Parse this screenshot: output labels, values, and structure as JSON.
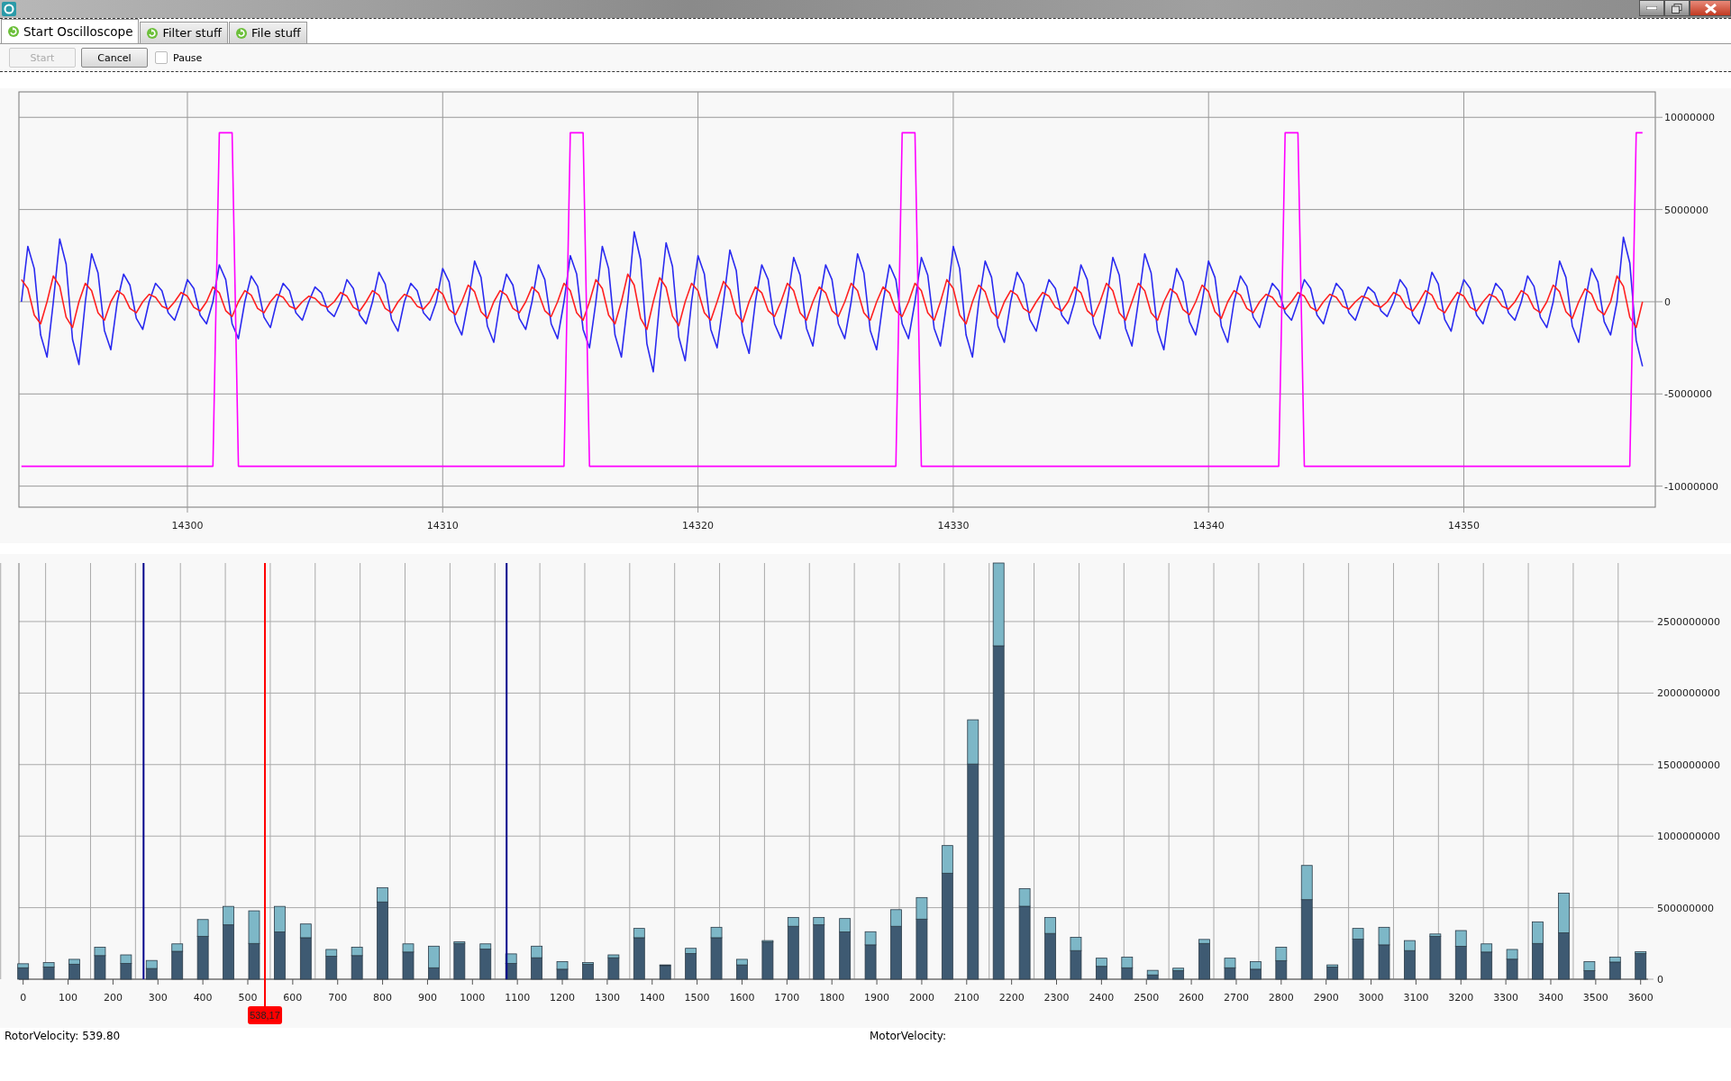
{
  "tabs": [
    {
      "label": "Start Oscilloscope",
      "selected": true
    },
    {
      "label": "Filter stuff",
      "selected": false
    },
    {
      "label": "File stuff",
      "selected": false
    }
  ],
  "toolbar": {
    "buttons": [
      {
        "label": "Start",
        "disabled": true
      },
      {
        "label": "Cancel",
        "disabled": false
      }
    ],
    "pause": {
      "label": "Pause",
      "checked": false
    }
  },
  "time_chart": {
    "chart_data": {
      "type": "line",
      "xlim": [
        14293.4,
        14357.5
      ],
      "ylim": [
        -11140000,
        11380000
      ],
      "grid": true,
      "xticks": [
        14300,
        14310,
        14320,
        14330,
        14340,
        14350
      ],
      "yticks": [
        -10000000,
        -5000000,
        0,
        5000000,
        10000000
      ],
      "x": [
        14293.5,
        14293.75,
        14294,
        14294.25,
        14294.5,
        14294.75,
        14295,
        14295.25,
        14295.5,
        14295.75,
        14296,
        14296.25,
        14296.5,
        14296.75,
        14297,
        14297.25,
        14297.5,
        14297.75,
        14298,
        14298.25,
        14298.5,
        14298.75,
        14299,
        14299.25,
        14299.5,
        14299.75,
        14300,
        14300.25,
        14300.5,
        14300.75,
        14301,
        14301.25,
        14301.5,
        14301.75,
        14302,
        14302.25,
        14302.5,
        14302.75,
        14303,
        14303.25,
        14303.5,
        14303.75,
        14304,
        14304.25,
        14304.5,
        14304.75,
        14305,
        14305.25,
        14305.5,
        14305.75,
        14306,
        14306.25,
        14306.5,
        14306.75,
        14307,
        14307.25,
        14307.5,
        14307.75,
        14308,
        14308.25,
        14308.5,
        14308.75,
        14309,
        14309.25,
        14309.5,
        14309.75,
        14310,
        14310.25,
        14310.5,
        14310.75,
        14311,
        14311.25,
        14311.5,
        14311.75,
        14312,
        14312.25,
        14312.5,
        14312.75,
        14313,
        14313.25,
        14313.5,
        14313.75,
        14314,
        14314.25,
        14314.5,
        14314.75,
        14315,
        14315.25,
        14315.5,
        14315.75,
        14316,
        14316.25,
        14316.5,
        14316.75,
        14317,
        14317.25,
        14317.5,
        14317.75,
        14318,
        14318.25,
        14318.5,
        14318.75,
        14319,
        14319.25,
        14319.5,
        14319.75,
        14320,
        14320.25,
        14320.5,
        14320.75,
        14321,
        14321.25,
        14321.5,
        14321.75,
        14322,
        14322.25,
        14322.5,
        14322.75,
        14323,
        14323.25,
        14323.5,
        14323.75,
        14324,
        14324.25,
        14324.5,
        14324.75,
        14325,
        14325.25,
        14325.5,
        14325.75,
        14326,
        14326.25,
        14326.5,
        14326.75,
        14327,
        14327.25,
        14327.5,
        14327.75,
        14328,
        14328.25,
        14328.5,
        14328.75,
        14329,
        14329.25,
        14329.5,
        14329.75,
        14330,
        14330.25,
        14330.5,
        14330.75,
        14331,
        14331.25,
        14331.5,
        14331.75,
        14332,
        14332.25,
        14332.5,
        14332.75,
        14333,
        14333.25,
        14333.5,
        14333.75,
        14334,
        14334.25,
        14334.5,
        14334.75,
        14335,
        14335.25,
        14335.5,
        14335.75,
        14336,
        14336.25,
        14336.5,
        14336.75,
        14337,
        14337.25,
        14337.5,
        14337.75,
        14338,
        14338.25,
        14338.5,
        14338.75,
        14339,
        14339.25,
        14339.5,
        14339.75,
        14340,
        14340.25,
        14340.5,
        14340.75,
        14341,
        14341.25,
        14341.5,
        14341.75,
        14342,
        14342.25,
        14342.5,
        14342.75,
        14343,
        14343.25,
        14343.5,
        14343.75,
        14344,
        14344.25,
        14344.5,
        14344.75,
        14345,
        14345.25,
        14345.5,
        14345.75,
        14346,
        14346.25,
        14346.5,
        14346.75,
        14347,
        14347.25,
        14347.5,
        14347.75,
        14348,
        14348.25,
        14348.5,
        14348.75,
        14349,
        14349.25,
        14349.5,
        14349.75,
        14350,
        14350.25,
        14350.5,
        14350.75,
        14351,
        14351.25,
        14351.5,
        14351.75,
        14352,
        14352.25,
        14352.5,
        14352.75,
        14353,
        14353.25,
        14353.5,
        14353.75,
        14354,
        14354.25,
        14354.5,
        14354.75,
        14355,
        14355.25,
        14355.5,
        14355.75,
        14356,
        14356.25,
        14356.5,
        14356.75,
        14357
      ],
      "series": [
        {
          "color": "#2a2af0",
          "values": [
            0,
            3000000.0,
            1800000.0,
            -1800000.0,
            -3000000.0,
            0,
            3400000.0,
            2040000.0,
            -2040000.0,
            -3400000.0,
            0,
            2600000.0,
            1560000.0,
            -1560000.0,
            -2600000.0,
            0,
            1500000.0,
            900000.0,
            -900000.0,
            -1500000.0,
            0,
            1000000.0,
            600000.0,
            -600000.0,
            -1000000.0,
            0,
            1200000.0,
            720000.0,
            -720000.0,
            -1200000.0,
            0,
            2000000.0,
            1200000.0,
            -1200000.0,
            -2000000.0,
            0,
            1400000.0,
            840000.0,
            -840000.0,
            -1400000.0,
            0,
            1000000.0,
            600000.0,
            -600000.0,
            -1000000.0,
            0,
            800000.0,
            480000.0,
            -480000.0,
            -800000.0,
            0,
            1200000.0,
            720000.0,
            -720000.0,
            -1200000.0,
            0,
            1600000.0,
            960000.0,
            -960000.0,
            -1600000.0,
            0,
            1000000.0,
            600000.0,
            -600000.0,
            -1000000.0,
            0,
            1800000.0,
            1080000.0,
            -1080000.0,
            -1800000.0,
            0,
            2200000.0,
            1320000.0,
            -1320000.0,
            -2200000.0,
            0,
            1500000.0,
            900000.0,
            -900000.0,
            -1500000.0,
            0,
            2000000.0,
            1200000.0,
            -1200000.0,
            -2000000.0,
            0,
            2500000.0,
            1500000.0,
            -1500000.0,
            -2500000.0,
            0,
            3000000.0,
            1800000.0,
            -1800000.0,
            -3000000.0,
            0,
            3800000.0,
            2280000.0,
            -2280000.0,
            -3800000.0,
            0,
            3200000.0,
            1920000.0,
            -1920000.0,
            -3200000.0,
            0,
            2500000.0,
            1500000.0,
            -1500000.0,
            -2500000.0,
            0,
            2800000.0,
            1680000.0,
            -1680000.0,
            -2800000.0,
            0,
            2000000.0,
            1200000.0,
            -1200000.0,
            -2000000.0,
            0,
            2400000.0,
            1440000.0,
            -1440000.0,
            -2400000.0,
            0,
            2000000.0,
            1200000.0,
            -1200000.0,
            -2000000.0,
            0,
            2600000.0,
            1560000.0,
            -1560000.0,
            -2600000.0,
            0,
            2000000.0,
            1200000.0,
            -1200000.0,
            -2000000.0,
            0,
            2400000.0,
            1440000.0,
            -1440000.0,
            -2400000.0,
            0,
            3000000.0,
            1800000.0,
            -1800000.0,
            -3000000.0,
            0,
            2200000.0,
            1320000.0,
            -1320000.0,
            -2200000.0,
            0,
            1600000.0,
            960000.0,
            -960000.0,
            -1600000.0,
            0,
            1200000.0,
            720000.0,
            -720000.0,
            -1200000.0,
            0,
            2000000.0,
            1200000.0,
            -1200000.0,
            -2000000.0,
            0,
            2400000.0,
            1440000.0,
            -1440000.0,
            -2400000.0,
            0,
            2600000.0,
            1560000.0,
            -1560000.0,
            -2600000.0,
            0,
            1800000.0,
            1080000.0,
            -1080000.0,
            -1800000.0,
            0,
            2200000.0,
            1320000.0,
            -1320000.0,
            -2200000.0,
            0,
            1400000.0,
            840000.0,
            -840000.0,
            -1400000.0,
            0,
            1000000.0,
            600000.0,
            -600000.0,
            -1000000.0,
            0,
            1200000.0,
            720000.0,
            -720000.0,
            -1200000.0,
            0,
            1000000.0,
            600000.0,
            -600000.0,
            -1000000.0,
            0,
            800000.0,
            480000.0,
            -480000.0,
            -800000.0,
            0,
            1200000.0,
            720000.0,
            -720000.0,
            -1200000.0,
            0,
            1600000.0,
            960000.0,
            -960000.0,
            -1600000.0,
            0,
            1200000.0,
            720000.0,
            -720000.0,
            -1200000.0,
            0,
            1000000.0,
            600000.0,
            -600000.0,
            -1000000.0,
            0,
            1400000.0,
            840000.0,
            -840000.0,
            -1400000.0,
            0,
            2200000.0,
            1320000.0,
            -1320000.0,
            -2200000.0,
            0,
            1800000.0,
            1080000.0,
            -1080000.0,
            -1800000.0,
            0,
            3500000.0,
            2100000.0,
            -2100000.0,
            -3500000.0
          ]
        },
        {
          "color": "#ff2020",
          "values": [
            1200000.0,
            720000.0,
            -720000.0,
            -1200000.0,
            0,
            1400000.0,
            840000.0,
            -840000.0,
            -1400000.0,
            0,
            1000000.0,
            600000.0,
            -600000.0,
            -1000000.0,
            0,
            600000.0,
            360000.0,
            -360000.0,
            -600000.0,
            0,
            400000.0,
            240000.0,
            -240000.0,
            -400000.0,
            0,
            500000.0,
            300000.0,
            -300000.0,
            -500000.0,
            0,
            800000.0,
            480000.0,
            -480000.0,
            -800000.0,
            0,
            600000.0,
            360000.0,
            -360000.0,
            -600000.0,
            0,
            400000.0,
            240000.0,
            -240000.0,
            -400000.0,
            0,
            300000.0,
            180000.0,
            -180000.0,
            -300000.0,
            0,
            500000.0,
            300000.0,
            -300000.0,
            -500000.0,
            0,
            600000.0,
            360000.0,
            -360000.0,
            -600000.0,
            0,
            400000.0,
            240000.0,
            -240000.0,
            -400000.0,
            0,
            700000.0,
            420000.0,
            -420000.0,
            -700000.0,
            0,
            900000.0,
            540000.0,
            -540000.0,
            -900000.0,
            0,
            600000.0,
            360000.0,
            -360000.0,
            -600000.0,
            0,
            800000.0,
            480000.0,
            -480000.0,
            -800000.0,
            0,
            1000000.0,
            600000.0,
            -600000.0,
            -1000000.0,
            0,
            1200000.0,
            720000.0,
            -720000.0,
            -1200000.0,
            0,
            1500000.0,
            900000.0,
            -900000.0,
            -1500000.0,
            0,
            1300000.0,
            780000.0,
            -780000.0,
            -1300000.0,
            0,
            1000000.0,
            600000.0,
            -600000.0,
            -1000000.0,
            0,
            1100000.0,
            660000.0,
            -660000.0,
            -1100000.0,
            0,
            800000.0,
            480000.0,
            -480000.0,
            -800000.0,
            0,
            1000000.0,
            600000.0,
            -600000.0,
            -1000000.0,
            0,
            800000.0,
            480000.0,
            -480000.0,
            -800000.0,
            0,
            1000000.0,
            600000.0,
            -600000.0,
            -1000000.0,
            0,
            800000.0,
            480000.0,
            -480000.0,
            -800000.0,
            0,
            1000000.0,
            600000.0,
            -600000.0,
            -1000000.0,
            0,
            1200000.0,
            720000.0,
            -720000.0,
            -1200000.0,
            0,
            900000.0,
            540000.0,
            -540000.0,
            -900000.0,
            0,
            600000.0,
            360000.0,
            -360000.0,
            -600000.0,
            0,
            500000.0,
            300000.0,
            -300000.0,
            -500000.0,
            0,
            800000.0,
            480000.0,
            -480000.0,
            -800000.0,
            0,
            1000000.0,
            600000.0,
            -600000.0,
            -1000000.0,
            0,
            1000000.0,
            600000.0,
            -600000.0,
            -1000000.0,
            0,
            700000.0,
            420000.0,
            -420000.0,
            -700000.0,
            0,
            900000.0,
            540000.0,
            -540000.0,
            -900000.0,
            0,
            600000.0,
            360000.0,
            -360000.0,
            -600000.0,
            0,
            400000.0,
            240000.0,
            -240000.0,
            -400000.0,
            0,
            500000.0,
            300000.0,
            -300000.0,
            -500000.0,
            0,
            400000.0,
            240000.0,
            -240000.0,
            -400000.0,
            0,
            300000.0,
            180000.0,
            -180000.0,
            -300000.0,
            0,
            500000.0,
            300000.0,
            -300000.0,
            -500000.0,
            0,
            600000.0,
            360000.0,
            -360000.0,
            -600000.0,
            0,
            500000.0,
            300000.0,
            -300000.0,
            -500000.0,
            0,
            400000.0,
            240000.0,
            -240000.0,
            -400000.0,
            0,
            600000.0,
            360000.0,
            -360000.0,
            -600000.0,
            0,
            900000.0,
            540000.0,
            -540000.0,
            -900000.0,
            0,
            700000.0,
            420000.0,
            -420000.0,
            -700000.0,
            0,
            1400000.0,
            840000.0,
            -840000.0,
            -1400000.0,
            0
          ]
        },
        {
          "color": "#ff00ff",
          "values": [
            -8920000.0,
            -8920000.0,
            -8920000.0,
            -8920000.0,
            -8920000.0,
            -8920000.0,
            -8920000.0,
            -8920000.0,
            -8920000.0,
            -8920000.0,
            -8920000.0,
            -8920000.0,
            -8920000.0,
            -8920000.0,
            -8920000.0,
            -8920000.0,
            -8920000.0,
            -8920000.0,
            -8920000.0,
            -8920000.0,
            -8920000.0,
            -8920000.0,
            -8920000.0,
            -8920000.0,
            -8920000.0,
            -8920000.0,
            -8920000.0,
            -8920000.0,
            -8920000.0,
            -8920000.0,
            -8920000.0,
            9160000.0,
            9160000.0,
            9160000.0,
            -8920000.0,
            -8920000.0,
            -8920000.0,
            -8920000.0,
            -8920000.0,
            -8920000.0,
            -8920000.0,
            -8920000.0,
            -8920000.0,
            -8920000.0,
            -8920000.0,
            -8920000.0,
            -8920000.0,
            -8920000.0,
            -8920000.0,
            -8920000.0,
            -8920000.0,
            -8920000.0,
            -8920000.0,
            -8920000.0,
            -8920000.0,
            -8920000.0,
            -8920000.0,
            -8920000.0,
            -8920000.0,
            -8920000.0,
            -8920000.0,
            -8920000.0,
            -8920000.0,
            -8920000.0,
            -8920000.0,
            -8920000.0,
            -8920000.0,
            -8920000.0,
            -8920000.0,
            -8920000.0,
            -8920000.0,
            -8920000.0,
            -8920000.0,
            -8920000.0,
            -8920000.0,
            -8920000.0,
            -8920000.0,
            -8920000.0,
            -8920000.0,
            -8920000.0,
            -8920000.0,
            -8920000.0,
            -8920000.0,
            -8920000.0,
            -8920000.0,
            -8920000.0,
            9160000.0,
            9160000.0,
            9160000.0,
            -8920000.0,
            -8920000.0,
            -8920000.0,
            -8920000.0,
            -8920000.0,
            -8920000.0,
            -8920000.0,
            -8920000.0,
            -8920000.0,
            -8920000.0,
            -8920000.0,
            -8920000.0,
            -8920000.0,
            -8920000.0,
            -8920000.0,
            -8920000.0,
            -8920000.0,
            -8920000.0,
            -8920000.0,
            -8920000.0,
            -8920000.0,
            -8920000.0,
            -8920000.0,
            -8920000.0,
            -8920000.0,
            -8920000.0,
            -8920000.0,
            -8920000.0,
            -8920000.0,
            -8920000.0,
            -8920000.0,
            -8920000.0,
            -8920000.0,
            -8920000.0,
            -8920000.0,
            -8920000.0,
            -8920000.0,
            -8920000.0,
            -8920000.0,
            -8920000.0,
            -8920000.0,
            -8920000.0,
            -8920000.0,
            -8920000.0,
            -8920000.0,
            -8920000.0,
            -8920000.0,
            -8920000.0,
            -8920000.0,
            9160000.0,
            9160000.0,
            9160000.0,
            -8920000.0,
            -8920000.0,
            -8920000.0,
            -8920000.0,
            -8920000.0,
            -8920000.0,
            -8920000.0,
            -8920000.0,
            -8920000.0,
            -8920000.0,
            -8920000.0,
            -8920000.0,
            -8920000.0,
            -8920000.0,
            -8920000.0,
            -8920000.0,
            -8920000.0,
            -8920000.0,
            -8920000.0,
            -8920000.0,
            -8920000.0,
            -8920000.0,
            -8920000.0,
            -8920000.0,
            -8920000.0,
            -8920000.0,
            -8920000.0,
            -8920000.0,
            -8920000.0,
            -8920000.0,
            -8920000.0,
            -8920000.0,
            -8920000.0,
            -8920000.0,
            -8920000.0,
            -8920000.0,
            -8920000.0,
            -8920000.0,
            -8920000.0,
            -8920000.0,
            -8920000.0,
            -8920000.0,
            -8920000.0,
            -8920000.0,
            -8920000.0,
            -8920000.0,
            -8920000.0,
            -8920000.0,
            -8920000.0,
            -8920000.0,
            -8920000.0,
            -8920000.0,
            -8920000.0,
            -8920000.0,
            -8920000.0,
            -8920000.0,
            -8920000.0,
            9160000.0,
            9160000.0,
            9160000.0,
            -8920000.0,
            -8920000.0,
            -8920000.0,
            -8920000.0,
            -8920000.0,
            -8920000.0,
            -8920000.0,
            -8920000.0,
            -8920000.0,
            -8920000.0,
            -8920000.0,
            -8920000.0,
            -8920000.0,
            -8920000.0,
            -8920000.0,
            -8920000.0,
            -8920000.0,
            -8920000.0,
            -8920000.0,
            -8920000.0,
            -8920000.0,
            -8920000.0,
            -8920000.0,
            -8920000.0,
            -8920000.0,
            -8920000.0,
            -8920000.0,
            -8920000.0,
            -8920000.0,
            -8920000.0,
            -8920000.0,
            -8920000.0,
            -8920000.0,
            -8920000.0,
            -8920000.0,
            -8920000.0,
            -8920000.0,
            -8920000.0,
            -8920000.0,
            -8920000.0,
            -8920000.0,
            -8920000.0,
            -8920000.0,
            -8920000.0,
            -8920000.0,
            -8920000.0,
            -8920000.0,
            -8920000.0,
            -8920000.0,
            -8920000.0,
            -8920000.0,
            -8920000.0,
            9160000.0,
            9160000.0
          ]
        }
      ]
    }
  },
  "spectrum_chart": {
    "chart_data": {
      "type": "bar",
      "stacked": true,
      "grid": true,
      "xlim": [
        -9.4,
        3616.6
      ],
      "ylim": [
        0,
        2909000000
      ],
      "xticks": [
        0,
        100,
        200,
        300,
        400,
        500,
        600,
        700,
        800,
        900,
        1000,
        1100,
        1200,
        1300,
        1400,
        1500,
        1600,
        1700,
        1800,
        1900,
        2000,
        2100,
        2200,
        2300,
        2400,
        2500,
        2600,
        2700,
        2800,
        2900,
        3000,
        3100,
        3200,
        3300,
        3400,
        3500,
        3600
      ],
      "yticks": [
        0,
        500000000,
        1000000000,
        1500000000,
        2000000000,
        2500000000
      ],
      "x": [
        0,
        57,
        114,
        171,
        229,
        286,
        343,
        400,
        457,
        514,
        571,
        629,
        686,
        743,
        800,
        857,
        914,
        971,
        1029,
        1086,
        1143,
        1200,
        1257,
        1314,
        1371,
        1429,
        1486,
        1543,
        1600,
        1657,
        1714,
        1771,
        1829,
        1886,
        1943,
        2000,
        2057,
        2114,
        2171,
        2229,
        2286,
        2343,
        2400,
        2457,
        2514,
        2571,
        2629,
        2686,
        2743,
        2800,
        2857,
        2914,
        2971,
        3029,
        3086,
        3143,
        3200,
        3257,
        3314,
        3371,
        3429,
        3486,
        3543,
        3600
      ],
      "series": [
        {
          "color": "#3e5a72",
          "values": [
            80000000,
            85000000,
            105000000,
            165000000,
            110000000,
            75000000,
            195000000,
            300000000,
            380000000,
            250000000,
            330000000,
            290000000,
            160000000,
            165000000,
            540000000,
            190000000,
            80000000,
            250000000,
            210000000,
            110000000,
            150000000,
            70000000,
            105000000,
            150000000,
            290000000,
            95000000,
            180000000,
            290000000,
            100000000,
            260000000,
            370000000,
            380000000,
            330000000,
            240000000,
            370000000,
            420000000,
            741000000,
            1504000000,
            2330000000,
            510000000,
            320000000,
            200000000,
            90000000,
            80000000,
            30000000,
            60000000,
            250000000,
            80000000,
            70000000,
            130000000,
            556000000,
            85000000,
            280000000,
            240000000,
            200000000,
            300000000,
            230000000,
            190000000,
            140000000,
            250000000,
            324000000,
            60000000,
            120000000,
            180000000
          ]
        },
        {
          "color": "#7db7c7",
          "values": [
            28000000,
            31000000,
            34000000,
            59000000,
            60000000,
            56000000,
            52000000,
            117000000,
            129000000,
            228000000,
            179000000,
            96000000,
            48000000,
            59000000,
            100000000,
            57000000,
            151000000,
            12000000,
            37000000,
            67000000,
            81000000,
            53000000,
            11000000,
            20000000,
            65000000,
            5000000,
            36000000,
            73000000,
            39000000,
            10000000,
            62000000,
            52000000,
            94000000,
            92000000,
            116000000,
            151000000,
            193000000,
            309000000,
            579000000,
            123000000,
            112000000,
            93000000,
            57000000,
            74000000,
            32000000,
            17000000,
            28000000,
            67000000,
            53000000,
            94000000,
            239000000,
            15000000,
            75000000,
            123000000,
            70000000,
            16000000,
            110000000,
            57000000,
            68000000,
            151000000,
            278000000,
            63000000,
            34000000,
            13000000
          ]
        }
      ],
      "ref_lines": [
        {
          "axis": "x",
          "value": 268,
          "color": "#00008b"
        },
        {
          "axis": "x",
          "value": 1076,
          "color": "#00008b"
        },
        {
          "axis": "x",
          "value": 538.17,
          "color": "#ff0000",
          "label": "538,17"
        }
      ]
    }
  },
  "status": [
    {
      "text": "RotorVelocity: 539.80"
    },
    {
      "text": "MotorVelocity:"
    }
  ]
}
